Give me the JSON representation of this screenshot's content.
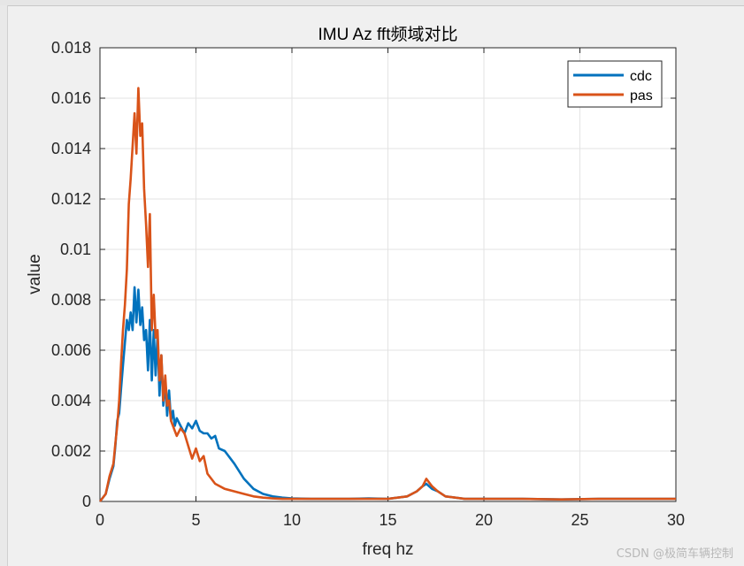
{
  "watermark": "CSDN @极简车辆控制",
  "chart_data": {
    "type": "line",
    "title": "IMU Az fft频域对比",
    "xlabel": "freq hz",
    "ylabel": "value",
    "xlim": [
      0,
      30
    ],
    "ylim": [
      0,
      0.018
    ],
    "xticks": [
      "0",
      "5",
      "10",
      "15",
      "20",
      "25",
      "30"
    ],
    "yticks": [
      "0",
      "0.002",
      "0.004",
      "0.006",
      "0.008",
      "0.01",
      "0.012",
      "0.014",
      "0.016",
      "0.018"
    ],
    "grid": true,
    "legend_position": "top-right",
    "series": [
      {
        "name": "cdc",
        "color": "#0072BD",
        "x": [
          0,
          0.3,
          0.5,
          0.7,
          0.8,
          0.9,
          1.0,
          1.1,
          1.2,
          1.3,
          1.4,
          1.5,
          1.6,
          1.7,
          1.8,
          1.9,
          2.0,
          2.1,
          2.2,
          2.3,
          2.4,
          2.5,
          2.6,
          2.7,
          2.8,
          2.9,
          3.0,
          3.1,
          3.2,
          3.3,
          3.4,
          3.5,
          3.6,
          3.7,
          3.8,
          3.9,
          4.0,
          4.2,
          4.4,
          4.6,
          4.8,
          5.0,
          5.2,
          5.4,
          5.6,
          5.8,
          6.0,
          6.2,
          6.5,
          7.0,
          7.5,
          8.0,
          8.5,
          9.0,
          9.5,
          10,
          11,
          12,
          13,
          14,
          15,
          16,
          16.5,
          16.8,
          17.0,
          17.3,
          17.6,
          18,
          19,
          20,
          22,
          24,
          26,
          28,
          30
        ],
        "y": [
          0,
          0.0003,
          0.0009,
          0.0014,
          0.0022,
          0.0032,
          0.0035,
          0.0045,
          0.0054,
          0.0063,
          0.0072,
          0.0068,
          0.0075,
          0.0068,
          0.0085,
          0.0071,
          0.0084,
          0.007,
          0.0077,
          0.0064,
          0.0068,
          0.0052,
          0.0072,
          0.0048,
          0.0068,
          0.005,
          0.0066,
          0.0042,
          0.0058,
          0.0038,
          0.0048,
          0.0034,
          0.0044,
          0.0032,
          0.0036,
          0.003,
          0.0033,
          0.003,
          0.0027,
          0.0031,
          0.0029,
          0.0032,
          0.0028,
          0.0027,
          0.0027,
          0.0025,
          0.0026,
          0.0021,
          0.002,
          0.0015,
          0.0009,
          0.0005,
          0.0003,
          0.0002,
          0.00015,
          0.00012,
          0.0001,
          0.0001,
          0.0001,
          0.00012,
          0.0001,
          0.0002,
          0.0004,
          0.0006,
          0.0007,
          0.0005,
          0.0004,
          0.0002,
          0.0001,
          0.0001,
          0.0001,
          8e-05,
          0.0001,
          0.0001,
          0.0001
        ]
      },
      {
        "name": "pas",
        "color": "#D95319",
        "x": [
          0,
          0.3,
          0.5,
          0.7,
          0.8,
          0.9,
          1.0,
          1.1,
          1.2,
          1.3,
          1.4,
          1.5,
          1.6,
          1.7,
          1.8,
          1.9,
          2.0,
          2.1,
          2.2,
          2.3,
          2.4,
          2.5,
          2.6,
          2.7,
          2.8,
          2.9,
          3.0,
          3.1,
          3.2,
          3.3,
          3.4,
          3.5,
          3.6,
          3.7,
          3.8,
          3.9,
          4.0,
          4.2,
          4.4,
          4.6,
          4.8,
          5.0,
          5.2,
          5.4,
          5.6,
          5.8,
          6.0,
          6.5,
          7.0,
          7.5,
          8.0,
          8.5,
          9.0,
          9.5,
          10,
          11,
          12,
          13,
          14,
          15,
          16,
          16.5,
          16.8,
          17.0,
          17.3,
          17.6,
          18,
          19,
          20,
          22,
          24,
          26,
          28,
          30
        ],
        "y": [
          0,
          0.0003,
          0.001,
          0.0015,
          0.0023,
          0.003,
          0.004,
          0.0055,
          0.0068,
          0.0078,
          0.0092,
          0.0118,
          0.0128,
          0.0141,
          0.0154,
          0.0138,
          0.0164,
          0.0145,
          0.015,
          0.0124,
          0.011,
          0.0093,
          0.0114,
          0.0068,
          0.0082,
          0.0065,
          0.0068,
          0.0048,
          0.0058,
          0.004,
          0.005,
          0.0038,
          0.004,
          0.0032,
          0.003,
          0.0028,
          0.0026,
          0.0029,
          0.0027,
          0.0022,
          0.0017,
          0.0021,
          0.0016,
          0.0018,
          0.0011,
          0.0009,
          0.0007,
          0.0005,
          0.0004,
          0.0003,
          0.0002,
          0.00015,
          0.00012,
          0.0001,
          0.0001,
          0.0001,
          0.0001,
          0.0001,
          0.0001,
          0.0001,
          0.0002,
          0.0004,
          0.0006,
          0.0009,
          0.0006,
          0.0004,
          0.0002,
          0.0001,
          0.0001,
          0.0001,
          8e-05,
          0.0001,
          0.0001,
          0.0001
        ]
      }
    ]
  }
}
